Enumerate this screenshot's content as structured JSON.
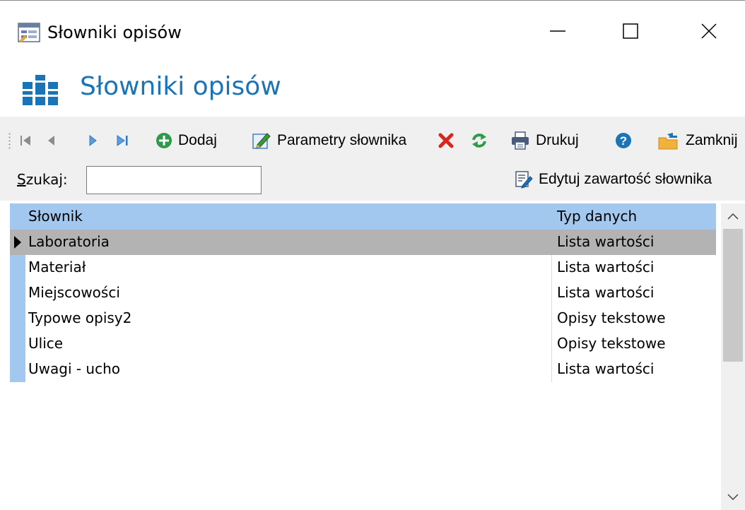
{
  "window": {
    "title": "Słowniki opisów",
    "buttons": [
      "minimize",
      "maximize",
      "close"
    ]
  },
  "header": {
    "title": "Słowniki opisów",
    "icon": "books-icon",
    "accent": "#1a74b8"
  },
  "toolbar": {
    "first_label": "",
    "prev_label": "",
    "next_label": "",
    "last_label": "",
    "add_label": "Dodaj",
    "params_label": "Parametry słownika",
    "print_label": "Drukuj",
    "close_label": "Zamknij"
  },
  "search": {
    "label_underlined": "S",
    "label_rest": "zukaj:",
    "value": "",
    "edit_content_label": "Edytuj zawartość słownika"
  },
  "grid": {
    "columns": [
      "Słownik",
      "Typ danych"
    ],
    "rows": [
      {
        "name": "Laboratoria",
        "type": "Lista wartości",
        "selected": true
      },
      {
        "name": "Materiał",
        "type": "Lista wartości",
        "selected": false
      },
      {
        "name": "Miejscowości",
        "type": "Lista wartości",
        "selected": false
      },
      {
        "name": "Typowe opisy2",
        "type": "Opisy tekstowe",
        "selected": false
      },
      {
        "name": "Ulice",
        "type": "Opisy tekstowe",
        "selected": false
      },
      {
        "name": "Uwagi - ucho",
        "type": "Lista wartości",
        "selected": false
      }
    ],
    "header_color": "#a3c8ef",
    "selected_color": "#b3b3b3"
  }
}
